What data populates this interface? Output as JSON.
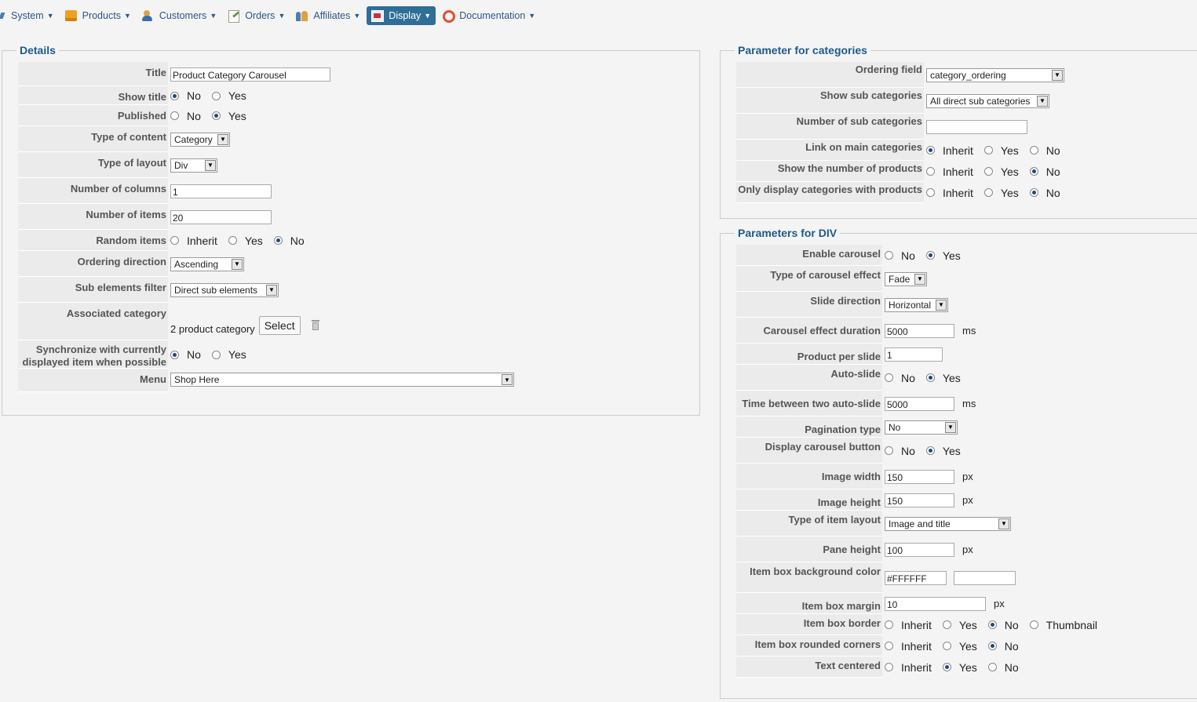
{
  "menu": [
    {
      "label": "System",
      "icon": "system-icon"
    },
    {
      "label": "Products",
      "icon": "products-icon"
    },
    {
      "label": "Customers",
      "icon": "customers-icon"
    },
    {
      "label": "Orders",
      "icon": "orders-icon"
    },
    {
      "label": "Affiliates",
      "icon": "affiliates-icon"
    },
    {
      "label": "Display",
      "icon": "display-icon",
      "active": true
    },
    {
      "label": "Documentation",
      "icon": "documentation-icon"
    }
  ],
  "details": {
    "legend": "Details",
    "title_label": "Title",
    "title_value": "Product Category Carousel",
    "show_title_label": "Show title",
    "show_title_opts": [
      "No",
      "Yes"
    ],
    "published_label": "Published",
    "published_opts": [
      "No",
      "Yes"
    ],
    "type_content_label": "Type of content",
    "type_content_value": "Category",
    "type_layout_label": "Type of layout",
    "type_layout_value": "Div",
    "num_columns_label": "Number of columns",
    "num_columns_value": "1",
    "num_items_label": "Number of items",
    "num_items_value": "20",
    "random_label": "Random items",
    "random_opts": [
      "Inherit",
      "Yes",
      "No"
    ],
    "ordering_dir_label": "Ordering direction",
    "ordering_dir_value": "Ascending",
    "sub_filter_label": "Sub elements filter",
    "sub_filter_value": "Direct sub elements",
    "assoc_label": "Associated category",
    "assoc_value": "2 product category",
    "assoc_button": "Select",
    "sync_label": "Synchronize with currently displayed item when possible",
    "sync_opts": [
      "No",
      "Yes"
    ],
    "menu_label": "Menu",
    "menu_value": "Shop Here"
  },
  "categories": {
    "legend": "Parameter for categories",
    "ordering_field_label": "Ordering field",
    "ordering_field_value": "category_ordering",
    "show_sub_label": "Show sub categories",
    "show_sub_value": "All direct sub categories",
    "num_sub_label": "Number of sub categories",
    "num_sub_value": "",
    "link_main_label": "Link on main categories",
    "show_num_products_label": "Show the number of products",
    "only_display_label": "Only display categories with products",
    "tri_opts": [
      "Inherit",
      "Yes",
      "No"
    ]
  },
  "div": {
    "legend": "Parameters for DIV",
    "enable_label": "Enable carousel",
    "yesno": [
      "No",
      "Yes"
    ],
    "effect_type_label": "Type of carousel effect",
    "effect_type_value": "Fade",
    "slide_dir_label": "Slide direction",
    "slide_dir_value": "Horizontal",
    "duration_label": "Carousel effect duration",
    "duration_value": "5000",
    "duration_unit": "ms",
    "per_slide_label": "Product per slide",
    "per_slide_value": "1",
    "autoslide_label": "Auto-slide",
    "between_label": "Time between two auto-slide",
    "between_value": "5000",
    "between_unit": "ms",
    "pagination_label": "Pagination type",
    "pagination_value": "No",
    "display_btn_label": "Display carousel button",
    "img_w_label": "Image width",
    "img_w_value": "150",
    "img_w_unit": "px",
    "img_h_label": "Image height",
    "img_h_value": "150",
    "img_h_unit": "px",
    "item_layout_label": "Type of item layout",
    "item_layout_value": "Image and title",
    "pane_h_label": "Pane height",
    "pane_h_value": "100",
    "pane_h_unit": "px",
    "bg_label": "Item box background color",
    "bg_value": "#FFFFFF",
    "margin_label": "Item box margin",
    "margin_value": "10",
    "margin_unit": "px",
    "border_label": "Item box border",
    "border_opts": [
      "Inherit",
      "Yes",
      "No",
      "Thumbnail"
    ],
    "rounded_label": "Item box rounded corners",
    "centered_label": "Text centered",
    "tri_opts": [
      "Inherit",
      "Yes",
      "No"
    ]
  }
}
